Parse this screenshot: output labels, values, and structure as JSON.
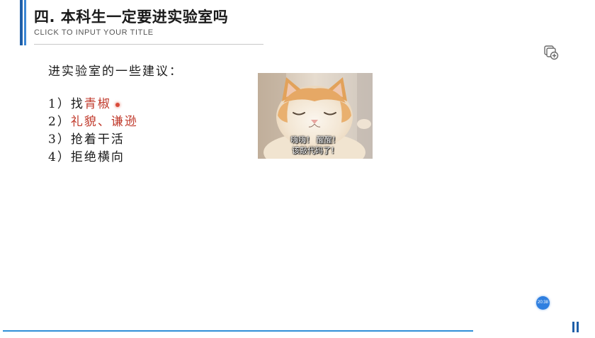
{
  "slide": {
    "title": "四. 本科生一定要进实验室吗",
    "subtitle": "CLICK TO INPUT YOUR TITLE"
  },
  "content": {
    "heading": "进实验室的一些建议：",
    "items": [
      {
        "num": "1）",
        "prefix": "找",
        "highlight": "青椒"
      },
      {
        "num": "2）",
        "prefix": "",
        "highlight": "礼貌、谦逊"
      },
      {
        "num": "3）",
        "prefix": "抢着干活",
        "highlight": ""
      },
      {
        "num": "4）",
        "prefix": "拒绝横向",
        "highlight": ""
      }
    ]
  },
  "image": {
    "caption_line1": "嗨嗨！ 醒醒！",
    "caption_line2": "该敲代码了！"
  },
  "widgets": {
    "timer": "20:38",
    "add_icon": "add-slide-icon",
    "pause_icon": "pause-icon"
  },
  "colors": {
    "accent": "#1f5fa8",
    "highlight_text": "#c0392b",
    "bottom_line": "#2f8fd8"
  }
}
